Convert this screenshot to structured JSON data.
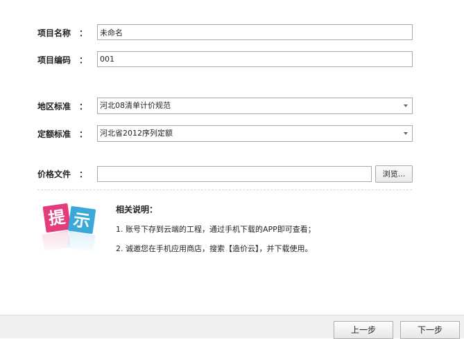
{
  "form": {
    "colon": "：",
    "project_name": {
      "label": "项目名称",
      "value": "未命名"
    },
    "project_code": {
      "label": "项目编码",
      "value": "001"
    },
    "region_standard": {
      "label": "地区标准",
      "value": "河北08清单计价规范"
    },
    "quota_standard": {
      "label": "定额标准",
      "value": "河北省2012序列定额"
    },
    "price_file": {
      "label": "价格文件",
      "value": "",
      "browse_label": "浏览..."
    }
  },
  "tip": {
    "icon_name": "tip-badge-icon",
    "icon_text": [
      "提",
      "示"
    ],
    "title": "相关说明：",
    "lines": [
      "1. 账号下存到云端的工程，通过手机下载的APP即可查看；",
      "2. 诚邀您在手机应用商店，搜索【造价云】，并下载使用。"
    ]
  },
  "footer": {
    "prev_label": "上一步",
    "next_label": "下一步"
  }
}
